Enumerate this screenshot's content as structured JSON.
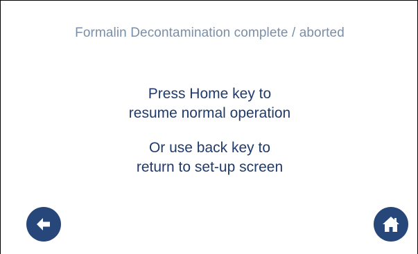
{
  "title": "Formalin Decontamination complete / aborted",
  "message_home": {
    "line1": "Press Home key to",
    "line2": "resume normal operation"
  },
  "message_back": {
    "line1": "Or use back key to",
    "line2": "return to set-up screen"
  },
  "buttons": {
    "back_icon": "arrow-left-icon",
    "home_icon": "home-icon"
  },
  "colors": {
    "title": "#7a8ea8",
    "text": "#1f3a6b",
    "button": "#27477b"
  }
}
